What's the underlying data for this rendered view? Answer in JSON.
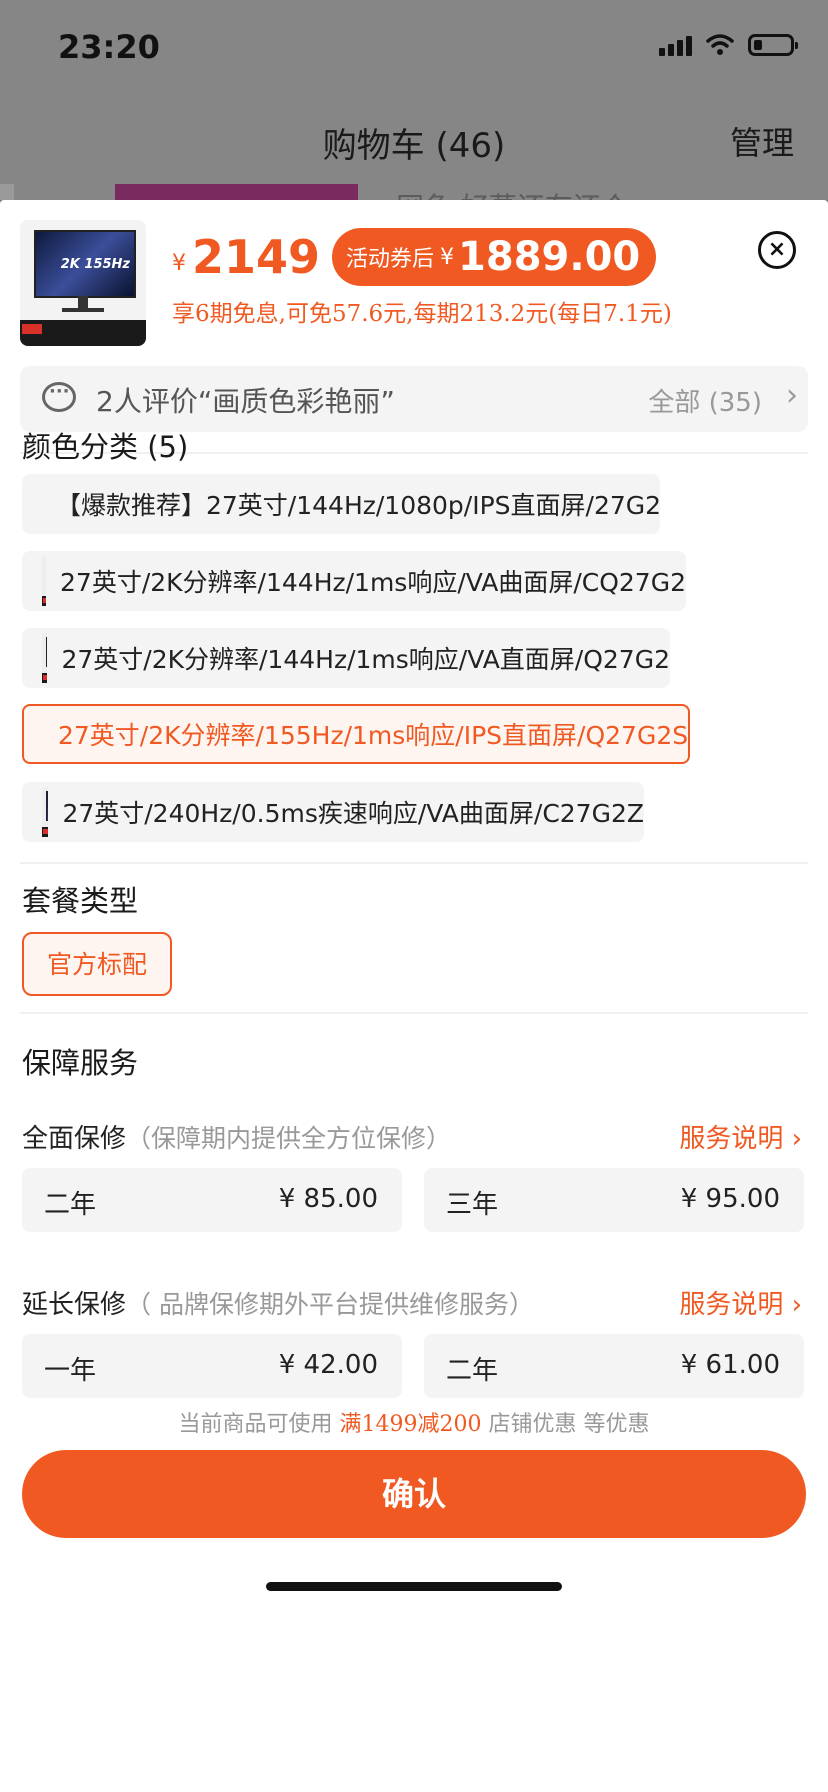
{
  "status_bar": {
    "time": "23:20"
  },
  "nav": {
    "title": "购物车 (46)",
    "manage": "管理"
  },
  "background": {
    "peek_text": "网鱼 好慕还有还个"
  },
  "product": {
    "price_prefix": "¥",
    "price": "2149",
    "coupon_label": "活动券后",
    "coupon_currency": "¥",
    "coupon_price": "1889.00",
    "installment_text": "享6期免息,可免57.6元,每期213.2元(每日7.1元)",
    "thumb_text": "2K 155Hz",
    "close_icon": "close-icon"
  },
  "reviews": {
    "summary": "2人评价“画质色彩艳丽”",
    "all_label": "全部 (35)",
    "chevron": "›"
  },
  "color_section": {
    "title": "颜色分类 (5)",
    "options": [
      {
        "label": "【爆款推荐】27英寸/144Hz/1080p/IPS直面屏/27G2",
        "selected": false
      },
      {
        "label": "27英寸/2K分辨率/144Hz/1ms响应/VA曲面屏/CQ27G2",
        "selected": false
      },
      {
        "label": "27英寸/2K分辨率/144Hz/1ms响应/VA直面屏/Q27G2",
        "selected": false
      },
      {
        "label": "27英寸/2K分辨率/155Hz/1ms响应/IPS直面屏/Q27G2S",
        "selected": true
      },
      {
        "label": "27英寸/240Hz/0.5ms疾速响应/VA曲面屏/C27G2Z",
        "selected": false
      }
    ]
  },
  "package_section": {
    "title": "套餐类型",
    "options": [
      {
        "label": "官方标配",
        "selected": true
      }
    ]
  },
  "service_section": {
    "title": "保障服务",
    "groups": [
      {
        "name": "全面保修",
        "subtitle": "（保障期内提供全方位保修）",
        "link": "服务说明 ›",
        "options": [
          {
            "term": "二年",
            "price": "¥ 85.00"
          },
          {
            "term": "三年",
            "price": "¥ 95.00"
          }
        ]
      },
      {
        "name": "延长保修",
        "subtitle": "（ 品牌保修期外平台提供维修服务）",
        "link": "服务说明 ›",
        "options": [
          {
            "term": "一年",
            "price": "¥ 42.00"
          },
          {
            "term": "二年",
            "price": "¥ 61.00"
          }
        ]
      }
    ]
  },
  "promo": {
    "prefix": "当前商品可使用",
    "highlight": "满1499减200",
    "suffix": "店铺优惠 等优惠"
  },
  "confirm_label": "确认",
  "colors": {
    "accent": "#f05a22",
    "dim_overlay": "#868686"
  }
}
